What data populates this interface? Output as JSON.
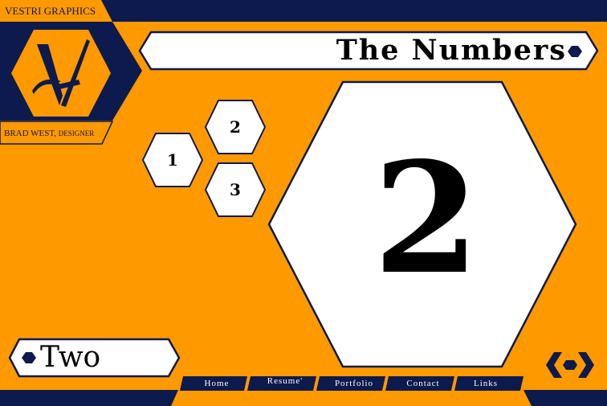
{
  "brand": {
    "name": "VESTRI GRAPHICS",
    "designer_name": "BRAD WEST,",
    "designer_role": "DESIGNER"
  },
  "header": {
    "title": "The Numbers"
  },
  "thumbs": [
    {
      "label": "1"
    },
    {
      "label": "2"
    },
    {
      "label": "3"
    }
  ],
  "main": {
    "big_number": "2",
    "caption": "Two"
  },
  "nav": {
    "items": [
      "Home",
      "Resume'",
      "Portfolio",
      "Contact",
      "Links"
    ]
  },
  "colors": {
    "orange": "#ff9900",
    "navy": "#0d1a4e",
    "white": "#ffffff"
  },
  "icons": {
    "logo": "v-monogram-hexagon",
    "nav_arrows": "left-right-arrows-hex-icon"
  }
}
